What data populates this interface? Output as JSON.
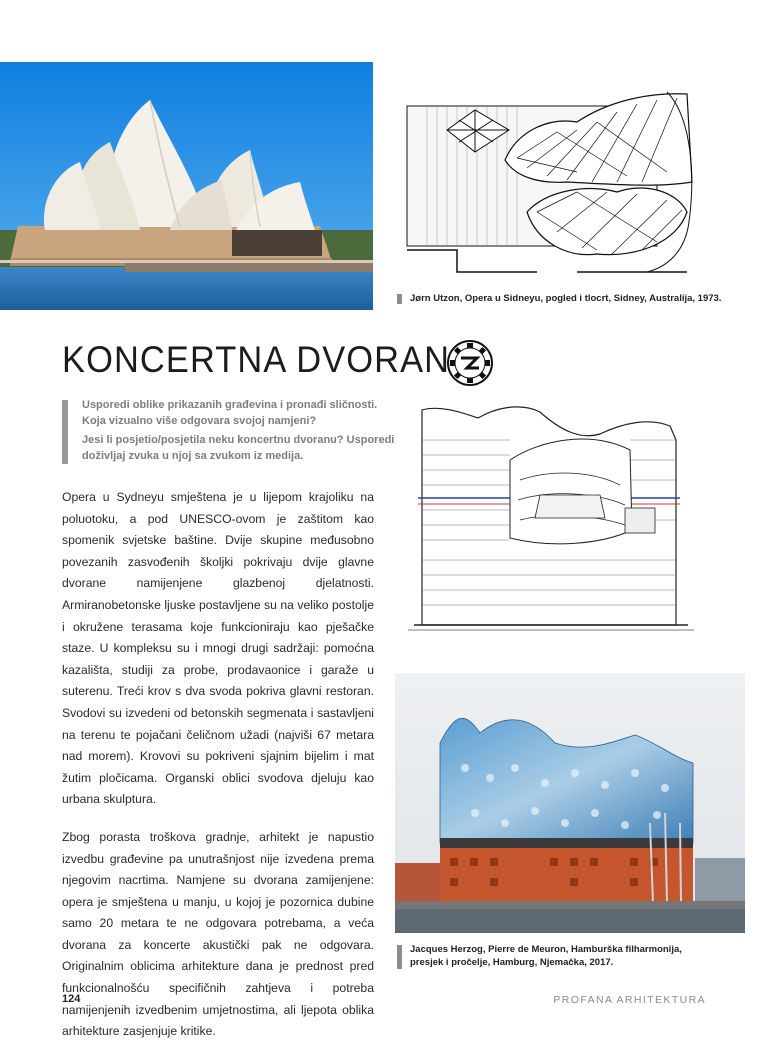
{
  "captions": {
    "sydney": "Jørn Utzon, Opera u Sidneyu, pogled i tlocrt, Sidney, Australija, 1973.",
    "hamburg_line1": "Jacques Herzog, Pierre de Meuron, Hamburška filharmonija,",
    "hamburg_line2": "presjek i pročelje, Hamburg, Njemačka, 2017."
  },
  "title": "KONCERTNA DVORANA",
  "task": {
    "q1": "Usporedi oblike prikazanih građevina i pronađi sličnosti. Koja vizualno više odgovara svojoj namjeni?",
    "q2": "Jesi li posjetio/posjetila neku koncertnu dvoranu? Usporedi doživljaj zvuka u njoj sa zvukom iz medija."
  },
  "body": {
    "p1": "Opera u Sydneyu smještena je u lijepom krajoliku na poluo­toku, a pod UNESCO-ovom je zaštitom kao spomenik svjet­ske baštine. Dvije skupine međusobno povezanih zasvo­đenih školjki pokrivaju dvije glavne dvorane namijenjene glazbenoj djelatnosti. Armiranobetonske ljuske postavlje­ne su na veliko postolje i okružene terasama koje funkci­oniraju kao pješačke staze. U kompleksu su i mnogi drugi sadržaji: pomoćna kazališta, studiji za probe, prodavaoni­ce i garaže u suterenu. Treći krov s dva svoda pokriva glav­ni restoran. Svodovi su izvedeni od betonskih segmenata i sastavljeni na terenu te pojačani čeličnom užadi (najviši 67 metara nad morem). Krovovi su pokriveni sjajnim bijelim i mat žutim pločicama. Organski oblici svodova djeluju kao urbana skulptura.",
    "p2": "Zbog porasta troškova gradnje, arhitekt je napustio izvedbu građevine pa unutrašnjost nije izvedena prema njegovim na­crtima. Namjene su dvorana zamijenjene: opera je smješte­na u manju, u kojoj je pozornica dubine samo 20 metara te ne odgovara potrebama, a veća dvorana za koncerte akustički pak ne odgovara. Originalnim oblicima arhitekture dana je prednost pred funkcionalnošću specifičnih zahtjeva i potre­ba namijenjenih izvedbenim umjetnostima, ali ljepota oblika arhitekture zasjenjuje kritike."
  },
  "footer": {
    "page_number": "124",
    "running_title": "PROFANA ARHITEKTURA"
  },
  "icons": {
    "stamp": "circular-stamp-icon"
  },
  "colors": {
    "sky": "#1e8fe6",
    "water": "#2f7fc4",
    "glass": "#7fb4d8",
    "brick": "#c4552c",
    "caption_bar": "#8c8c8c"
  }
}
